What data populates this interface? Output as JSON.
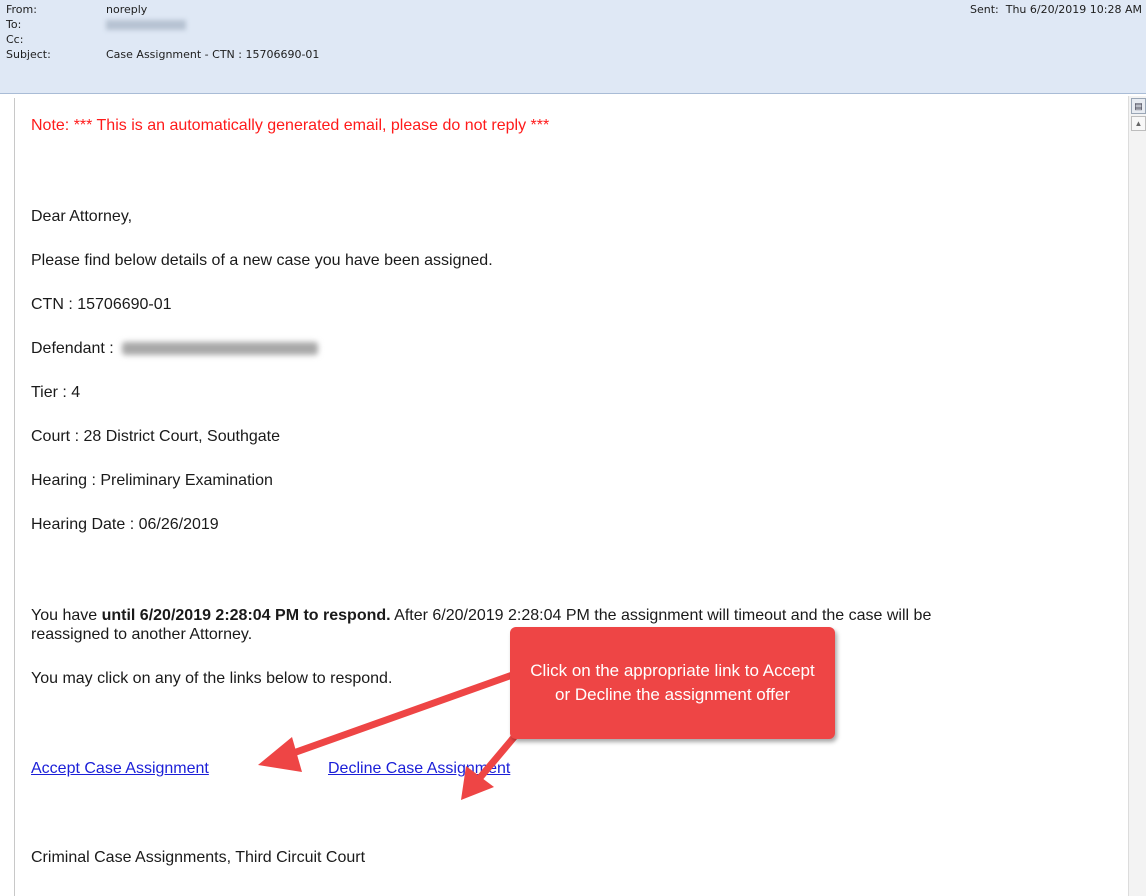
{
  "header": {
    "from_label": "From:",
    "from_value": "noreply",
    "to_label": "To:",
    "cc_label": "Cc:",
    "subject_label": "Subject:",
    "subject_value": "Case Assignment - CTN : 15706690-01",
    "sent_label": "Sent:",
    "sent_value": "Thu 6/20/2019 10:28 AM"
  },
  "body": {
    "note": "Note: *** This is an automatically generated email, please do not reply ***",
    "greeting": "Dear Attorney,",
    "intro": "Please find below details of a new case you have been assigned.",
    "ctn": "CTN : 15706690-01",
    "defendant_label": "Defendant :",
    "tier": "Tier : 4",
    "court": "Court : 28 District Court, Southgate",
    "hearing": "Hearing : Preliminary Examination",
    "hearing_date": "Hearing Date : 06/26/2019",
    "deadline_prefix": "You have ",
    "deadline_bold": "until 6/20/2019 2:28:04 PM to respond.",
    "deadline_suffix": " After 6/20/2019 2:28:04 PM the assignment will timeout and the case will be",
    "deadline_line2": "reassigned to another Attorney.",
    "links_intro": "You may click on any of the links below to respond.",
    "accept_link": "Accept Case Assignment",
    "decline_link": "Decline Case Assignment",
    "signature": "Criminal Case Assignments, Third Circuit Court"
  },
  "callout": {
    "text": "Click on the appropriate link to Accept or Decline the assignment offer",
    "color": "#ee4545"
  },
  "colors": {
    "note": "#ff1a1a",
    "link": "#1b1fd8",
    "header_bg": "#dfe8f5"
  }
}
